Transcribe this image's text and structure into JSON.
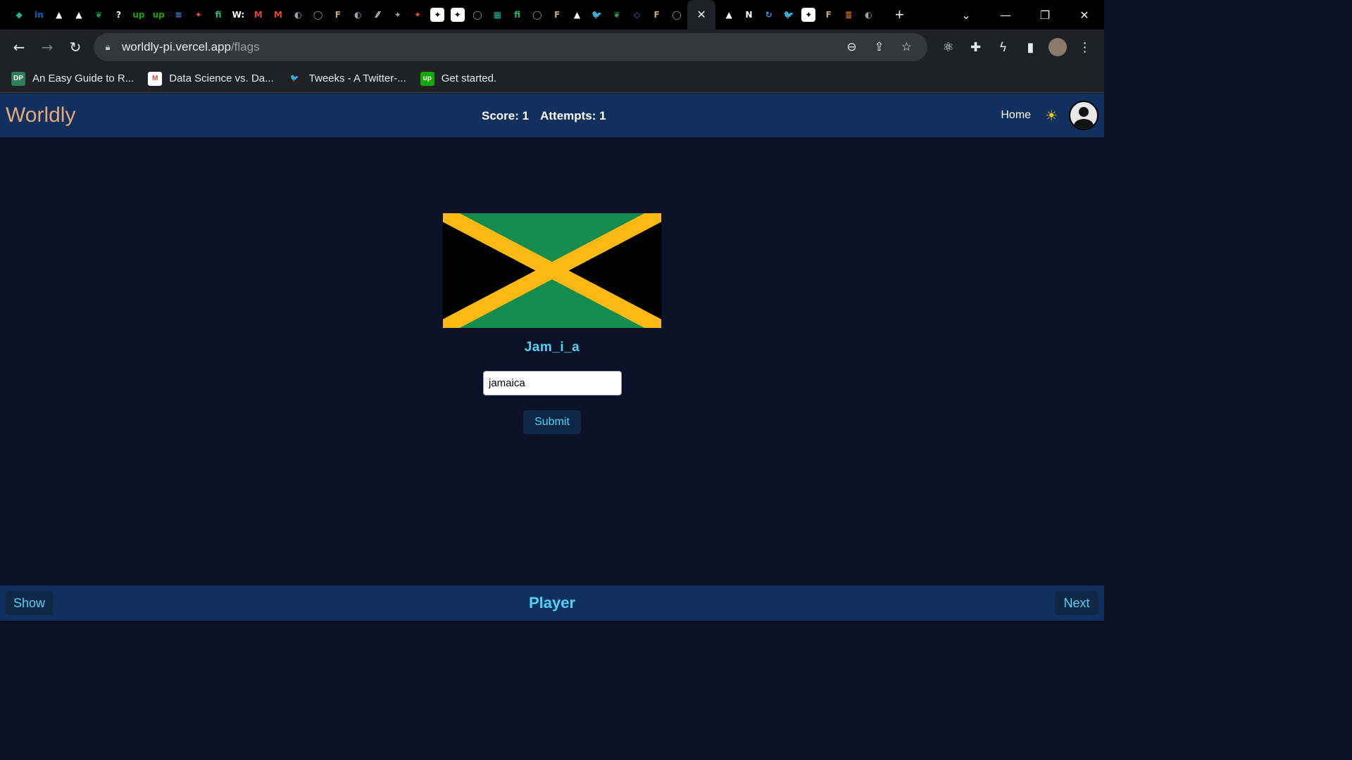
{
  "browser": {
    "tabs": [
      {
        "icon": "diamond-icon",
        "glyph": "◆",
        "color": "#1fb59a"
      },
      {
        "icon": "linkedin-icon",
        "glyph": "in",
        "color": "#0a66c2"
      },
      {
        "icon": "drive-icon",
        "glyph": "▲",
        "color": "#ffffff"
      },
      {
        "icon": "drive-icon",
        "glyph": "▲",
        "color": "#ffffff"
      },
      {
        "icon": "mongodb-icon",
        "glyph": "❦",
        "color": "#13aa52"
      },
      {
        "icon": "help-icon",
        "glyph": "?",
        "color": "#ffffff"
      },
      {
        "icon": "upwork-icon",
        "glyph": "up",
        "color": "#14a800"
      },
      {
        "icon": "upwork-icon",
        "glyph": "up",
        "color": "#14a800"
      },
      {
        "icon": "docs-icon",
        "glyph": "≡",
        "color": "#4285f4"
      },
      {
        "icon": "figma-icon",
        "glyph": "✦",
        "color": "#f24e1e"
      },
      {
        "icon": "fiverr-icon",
        "glyph": "fi",
        "color": "#1dbf73"
      },
      {
        "icon": "w-icon",
        "glyph": "W:",
        "color": "#ffffff"
      },
      {
        "icon": "gmail-icon",
        "glyph": "M",
        "color": "#ea4335"
      },
      {
        "icon": "gmail-icon",
        "glyph": "M",
        "color": "#ea4335"
      },
      {
        "icon": "globe-icon",
        "glyph": "◐",
        "color": "#9aa0a6"
      },
      {
        "icon": "github-icon",
        "glyph": "◯",
        "color": "#9aa0a6"
      },
      {
        "icon": "f-icon",
        "glyph": "F",
        "color": "#c8a66a"
      },
      {
        "icon": "globe-icon",
        "glyph": "◐",
        "color": "#9aa0a6"
      },
      {
        "icon": "slash-icon",
        "glyph": "⁄⁄",
        "color": "#e8eaed"
      },
      {
        "icon": "figma-icon",
        "glyph": "✦",
        "color": "#9aa0a6"
      },
      {
        "icon": "figma-icon",
        "glyph": "✦",
        "color": "#f24e1e"
      },
      {
        "icon": "sparkle-icon",
        "glyph": "✦",
        "color": "#000000"
      },
      {
        "icon": "sparkle-icon",
        "glyph": "✦",
        "color": "#000000"
      },
      {
        "icon": "github-icon",
        "glyph": "◯",
        "color": "#9aa0a6"
      },
      {
        "icon": "grid-icon",
        "glyph": "▦",
        "color": "#1fb59a"
      },
      {
        "icon": "fiverr-icon",
        "glyph": "fi",
        "color": "#1dbf73"
      },
      {
        "icon": "github-icon",
        "glyph": "◯",
        "color": "#9aa0a6"
      },
      {
        "icon": "f-icon",
        "glyph": "F",
        "color": "#c8a66a"
      },
      {
        "icon": "drive-icon",
        "glyph": "▲",
        "color": "#ffffff"
      },
      {
        "icon": "twitter-icon",
        "glyph": "🐦",
        "color": "#1d9bf0"
      },
      {
        "icon": "mongodb-icon",
        "glyph": "❦",
        "color": "#13aa52"
      },
      {
        "icon": "diamond-icon",
        "glyph": "◇",
        "color": "#4a6cf7"
      },
      {
        "icon": "f-icon",
        "glyph": "F",
        "color": "#c8a66a"
      },
      {
        "icon": "github-icon",
        "glyph": "◯",
        "color": "#9aa0a6"
      }
    ],
    "active_tab_close": "✕",
    "tabs_after": [
      {
        "icon": "drive-icon",
        "glyph": "▲",
        "color": "#ffffff"
      },
      {
        "icon": "notion-icon",
        "glyph": "N",
        "color": "#ffffff"
      },
      {
        "icon": "refresh-icon",
        "glyph": "↻",
        "color": "#1d9bf0"
      },
      {
        "icon": "twitter-icon",
        "glyph": "🐦",
        "color": "#1d9bf0"
      },
      {
        "icon": "sparkle-icon",
        "glyph": "✦",
        "color": "#000000"
      },
      {
        "icon": "f-icon",
        "glyph": "F",
        "color": "#c8a66a"
      },
      {
        "icon": "stackoverflow-icon",
        "glyph": "≣",
        "color": "#f48024"
      },
      {
        "icon": "globe-icon",
        "glyph": "◐",
        "color": "#9aa0a6"
      }
    ],
    "new_tab": "+",
    "url_host": "worldly-pi.vercel.app",
    "url_path": "/flags",
    "bookmarks": [
      {
        "label": "An Easy Guide to R...",
        "icon": "dp-icon",
        "glyph": "DP",
        "color": "#2e7d5b"
      },
      {
        "label": "Data Science vs. Da...",
        "icon": "gmail-icon",
        "glyph": "M",
        "color": "#ea4335"
      },
      {
        "label": "Tweeks - A Twitter-...",
        "icon": "twitter-icon",
        "glyph": "🐦",
        "color": "#1d9bf0"
      },
      {
        "label": "Get started.",
        "icon": "upwork-icon",
        "glyph": "up",
        "color": "#14a800"
      }
    ]
  },
  "app": {
    "brand": "Worldly",
    "score": "Score: 1",
    "attempts": "Attempts: 1",
    "home": "Home",
    "sun_icon": "☀"
  },
  "game": {
    "flag_country_colors": {
      "green": "#148c4e",
      "gold": "#fdb913",
      "black": "#000000"
    },
    "hint": "Jam_i_a",
    "answer_value": "jamaica",
    "submit_label": "Submit"
  },
  "footer": {
    "show_label": "Show",
    "player_label": "Player",
    "next_label": "Next"
  }
}
